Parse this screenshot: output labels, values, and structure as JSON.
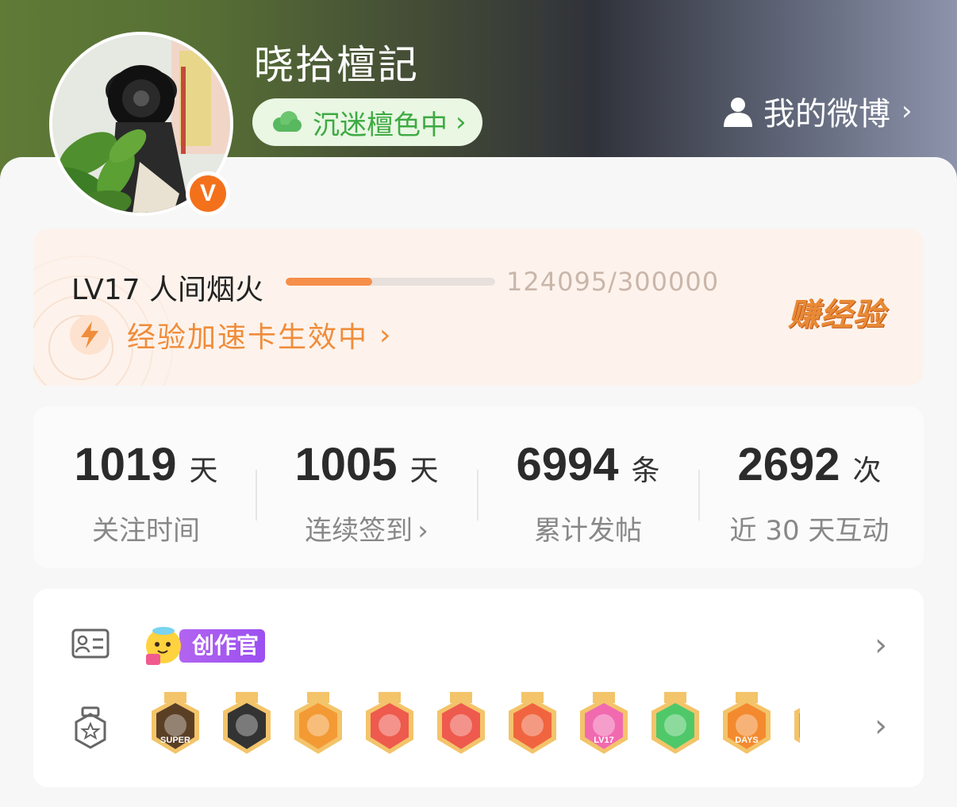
{
  "profile": {
    "username": "晓拾檀記",
    "status": "沉迷檀色中",
    "verified_mark": "V",
    "my_weibo_label": "我的微博"
  },
  "level": {
    "title": "LV17 人间烟火",
    "progress_text": "124095/300000",
    "progress_fraction": 0.4136,
    "boost_text": "经验加速卡生效中",
    "earn_label": "赚经验"
  },
  "stats": [
    {
      "value": "1019",
      "unit": "天",
      "label": "关注时间",
      "has_chevron": false
    },
    {
      "value": "1005",
      "unit": "天",
      "label": "连续签到",
      "has_chevron": true
    },
    {
      "value": "6994",
      "unit": "条",
      "label": "累计发帖",
      "has_chevron": false
    },
    {
      "value": "2692",
      "unit": "次",
      "label": "近 30 天互动",
      "has_chevron": false
    }
  ],
  "identity_row": {
    "tag_label": "创作官"
  },
  "medals": [
    {
      "icon": "super-crown-medal-icon",
      "text": "SUPER",
      "color": "#5a3f25"
    },
    {
      "icon": "clapperboard-medal-icon",
      "text": "",
      "color": "#333333"
    },
    {
      "icon": "gold-crown-medal-icon",
      "text": "",
      "color": "#f39a35"
    },
    {
      "icon": "dragon-red-medal-icon",
      "text": "",
      "color": "#ee5a4d"
    },
    {
      "icon": "dragon-red-medal-icon-2",
      "text": "",
      "color": "#ee5a4d"
    },
    {
      "icon": "fire-dragon-medal-icon",
      "text": "",
      "color": "#f0653f"
    },
    {
      "icon": "lv17-medal-icon",
      "text": "LV17",
      "color": "#f16ab0"
    },
    {
      "icon": "green-hand-medal-icon",
      "text": "",
      "color": "#4fc869"
    },
    {
      "icon": "100-days-medal-icon",
      "text": "DAYS",
      "color": "#f38a2f"
    },
    {
      "icon": "partial-medal-icon",
      "text": "",
      "color": "#f07a7a"
    }
  ],
  "colors": {
    "accent_orange": "#f58f49",
    "status_green": "#3eaa43",
    "creator_purple": "#a85af0"
  }
}
